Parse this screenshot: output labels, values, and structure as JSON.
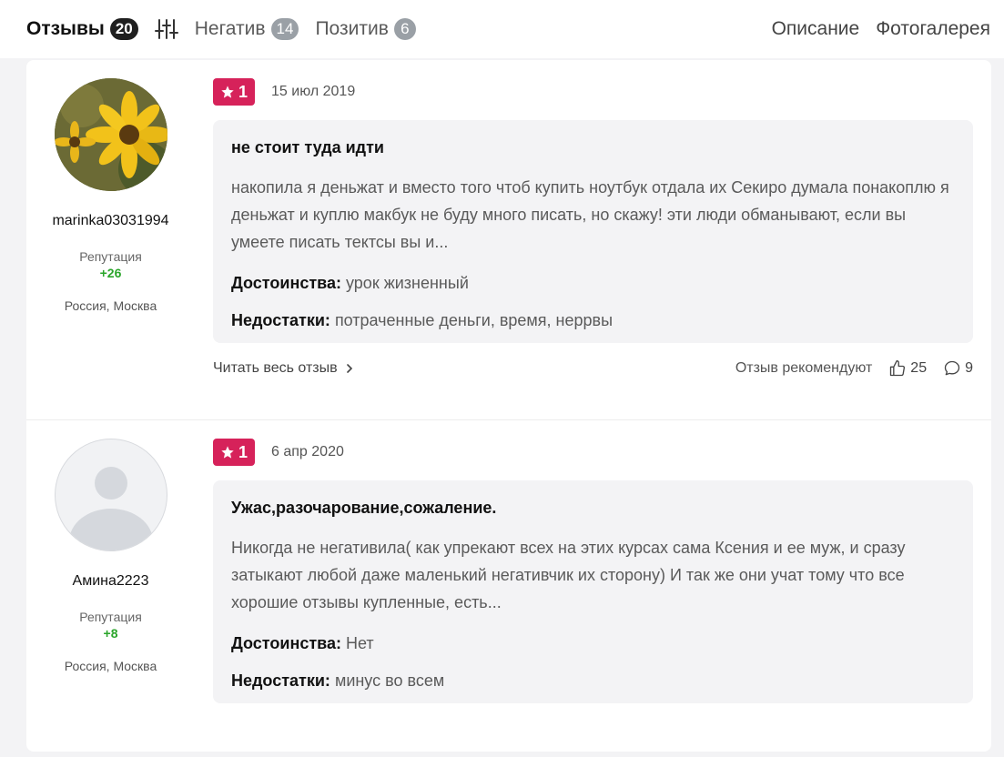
{
  "tabs": {
    "reviews_label": "Отзывы",
    "reviews_count": "20",
    "negative_label": "Негатив",
    "negative_count": "14",
    "positive_label": "Позитив",
    "positive_count": "6",
    "description_label": "Описание",
    "gallery_label": "Фотогалерея"
  },
  "reviews": [
    {
      "user": {
        "name": "marinka03031994",
        "reputation_label": "Репутация",
        "reputation": "+26",
        "location": "Россия, Москва"
      },
      "rating": "1",
      "date": "15 июл 2019",
      "title": "не стоит туда идти",
      "text": "накопила я деньжат и вместо того чтоб купить ноутбук отдала их Секиро думала понакоплю я деньжат и куплю макбук не буду много писать, но скажу! эти люди обманывают, если вы умеете писать тектсы вы и...",
      "pros_label": "Достоинства:",
      "pros": "урок жизненный",
      "cons_label": "Недостатки:",
      "cons": "потраченные деньги, время, неррвы",
      "read_more": "Читать весь отзыв",
      "recommend_label": "Отзыв рекомендуют",
      "likes": "25",
      "comments": "9"
    },
    {
      "user": {
        "name": "Амина2223",
        "reputation_label": "Репутация",
        "reputation": "+8",
        "location": "Россия, Москва"
      },
      "rating": "1",
      "date": "6 апр 2020",
      "title": "Ужас,разочарование,сожаление.",
      "text": "Никогда не негативила( как упрекают всех на этих курсах сама Ксения и ее муж, и сразу затыкают любой даже маленький негативчик их сторону) И так же они учат тому что все хорошие отзывы купленные, есть...",
      "pros_label": "Достоинства:",
      "pros": "Нет",
      "cons_label": "Недостатки:",
      "cons": "минус во всем"
    }
  ],
  "colors": {
    "rating_badge": "#d6225a",
    "reputation": "#2aa52a"
  }
}
